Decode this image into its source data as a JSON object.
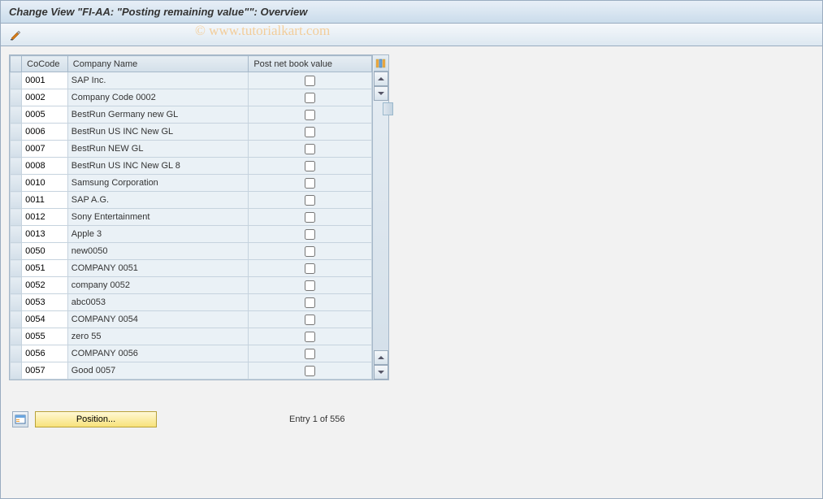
{
  "title": "Change View \"FI-AA: \"Posting remaining value\"\": Overview",
  "watermark": "© www.tutorialkart.com",
  "columns": {
    "cocode": "CoCode",
    "name": "Company Name",
    "post": "Post net book value"
  },
  "rows": [
    {
      "code": "0001",
      "name": "SAP Inc.",
      "post": false
    },
    {
      "code": "0002",
      "name": "Company Code 0002",
      "post": false
    },
    {
      "code": "0005",
      "name": "BestRun Germany new GL",
      "post": false
    },
    {
      "code": "0006",
      "name": "BestRun US INC New GL",
      "post": false
    },
    {
      "code": "0007",
      "name": "BestRun NEW GL",
      "post": false
    },
    {
      "code": "0008",
      "name": "BestRun US INC New GL 8",
      "post": false
    },
    {
      "code": "0010",
      "name": "Samsung Corporation",
      "post": false
    },
    {
      "code": "0011",
      "name": "SAP A.G.",
      "post": false
    },
    {
      "code": "0012",
      "name": "Sony Entertainment",
      "post": false
    },
    {
      "code": "0013",
      "name": "Apple 3",
      "post": false
    },
    {
      "code": "0050",
      "name": "new0050",
      "post": false
    },
    {
      "code": "0051",
      "name": "COMPANY 0051",
      "post": false
    },
    {
      "code": "0052",
      "name": "company 0052",
      "post": false
    },
    {
      "code": "0053",
      "name": "abc0053",
      "post": false
    },
    {
      "code": "0054",
      "name": "COMPANY 0054",
      "post": false
    },
    {
      "code": "0055",
      "name": "zero 55",
      "post": false
    },
    {
      "code": "0056",
      "name": "COMPANY 0056",
      "post": false
    },
    {
      "code": "0057",
      "name": "Good 0057",
      "post": false
    }
  ],
  "footer": {
    "position_label": "Position...",
    "entry_text": "Entry 1 of 556"
  },
  "icons": {
    "config": "config-tool-icon",
    "columns": "columns-icon"
  }
}
